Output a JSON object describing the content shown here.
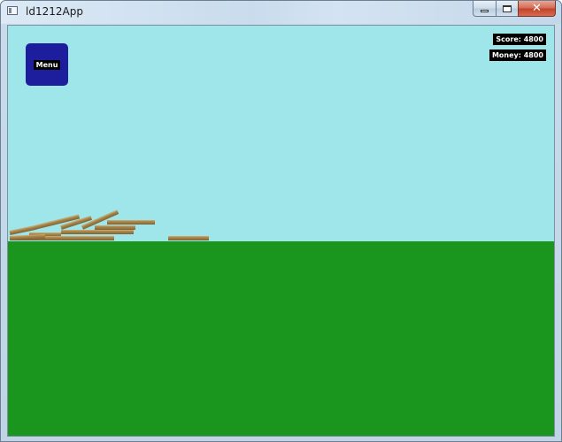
{
  "window": {
    "title": "ld1212App",
    "minimize_icon": "minimize-icon",
    "maximize_icon": "maximize-icon",
    "close_glyph": "✕"
  },
  "game": {
    "sky_color": "#9ee6e9",
    "ground_color": "#1a961e",
    "menu_button": {
      "label": "Menu",
      "color": "#1c1e9e"
    },
    "hud": {
      "score": "Score: 4800",
      "money": "Money: 4800"
    },
    "planks": {
      "count": 11,
      "color": "#9a7a43"
    }
  }
}
